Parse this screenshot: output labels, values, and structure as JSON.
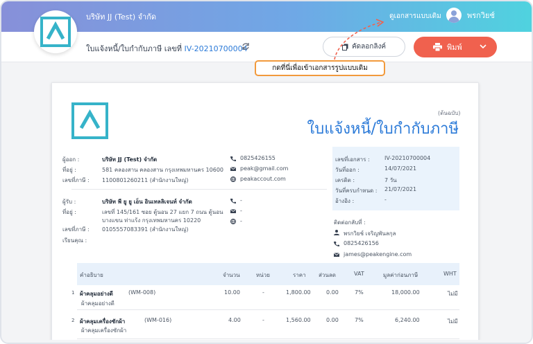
{
  "header": {
    "company": "บริษัท JJ (Test) จำกัด",
    "view_original": "ดูเอกสารแบบเดิม",
    "user": "พรกวิยช์"
  },
  "subbar": {
    "title_prefix": "ใบแจ้งหนี้/ใบกำกับภาษี เลขที่",
    "doc_no": "IV-20210700004",
    "copy_link": "คัดลอกลิงค์",
    "print": "พิมพ์"
  },
  "callout": "กดที่นี่เพื่อเข้าเอกสารรูปแบบเดิม",
  "document": {
    "original_label": "(ต้นฉบับ)",
    "title": "ใบแจ้งหนี้/ใบกำกับภาษี",
    "issuer": {
      "label_issuer": "ผู้ออก :",
      "issuer_name": "บริษัท JJ (Test) จำกัด",
      "label_address": "ที่อยู่ :",
      "address": "581 คลองสาน คลองสาน กรุงเทพมหานคร 10600",
      "label_tax": "เลขที่ภาษี :",
      "tax": "1100801260211 (สำนักงานใหญ่)",
      "phone": "0825426155",
      "email": "peak@gmail.com",
      "web": "peakaccout.com"
    },
    "customer": {
      "label_customer": "ผู้รับ :",
      "customer_name": "บริษัท พี ยู ยู เอ็น อินเทลลิเจนท์ จำกัด",
      "label_address": "ที่อยู่ :",
      "address_line1": "เลขที่ 145/161 ซอย ตู้นอน 27 แยก 7 ถนน ตู้นอน",
      "address_line2": "บางแขน ท่าแร้ง กรุงเทพมหานคร 10220",
      "label_tax": "เลขที่ภาษี :",
      "tax": "0105557083391 (สำนักงานใหญ่)",
      "label_attn": "เรียนคุณ :",
      "phone": "-",
      "email": "-",
      "web": "-"
    },
    "meta": {
      "label_docno": "เลขที่เอกสาร :",
      "docno": "IV-20210700004",
      "label_issue": "วันที่ออก :",
      "issue": "14/07/2021",
      "label_credit": "เครดิต :",
      "credit": "7 วัน",
      "label_due": "วันที่ครบกำหนด :",
      "due": "21/07/2021",
      "label_ref": "อ้างอิง :",
      "ref": "-"
    },
    "contact": {
      "label": "ติดต่อกลับที่ :",
      "name": "พรกวิยช์ เจริญพันลกุล",
      "phone": "0825426156",
      "email": "james@peakengine.com"
    },
    "table": {
      "headers": [
        "คำอธิบาย",
        "จำนวน",
        "หน่วย",
        "ราคา",
        "ส่วนลด",
        "VAT",
        "มูลค่าก่อนภาษี",
        "WHT"
      ],
      "rows": [
        {
          "no": "1",
          "name": "ผ้าคลุมอย่างดี",
          "code": "(WM-008)",
          "desc": "ผ้าคลุมอย่างดี",
          "qty": "10.00",
          "unit": "-",
          "price": "1,800.00",
          "discount": "0.00",
          "vat": "7%",
          "amount": "18,000.00",
          "wht": "ไม่มี"
        },
        {
          "no": "2",
          "name": "ผ้าคลุมเครื่องซักผ้า",
          "code": "(WM-016)",
          "desc": "ผ้าคลุมเครื่องซักผ้า",
          "qty": "4.00",
          "unit": "-",
          "price": "1,560.00",
          "discount": "0.00",
          "vat": "7%",
          "amount": "6,240.00",
          "wht": "ไม่มี"
        }
      ]
    }
  },
  "colors": {
    "accent_blue": "#2b7ad8",
    "print_button": "#f0614e",
    "callout_border": "#f29a3c",
    "logo_teal": "#36b3c9"
  }
}
